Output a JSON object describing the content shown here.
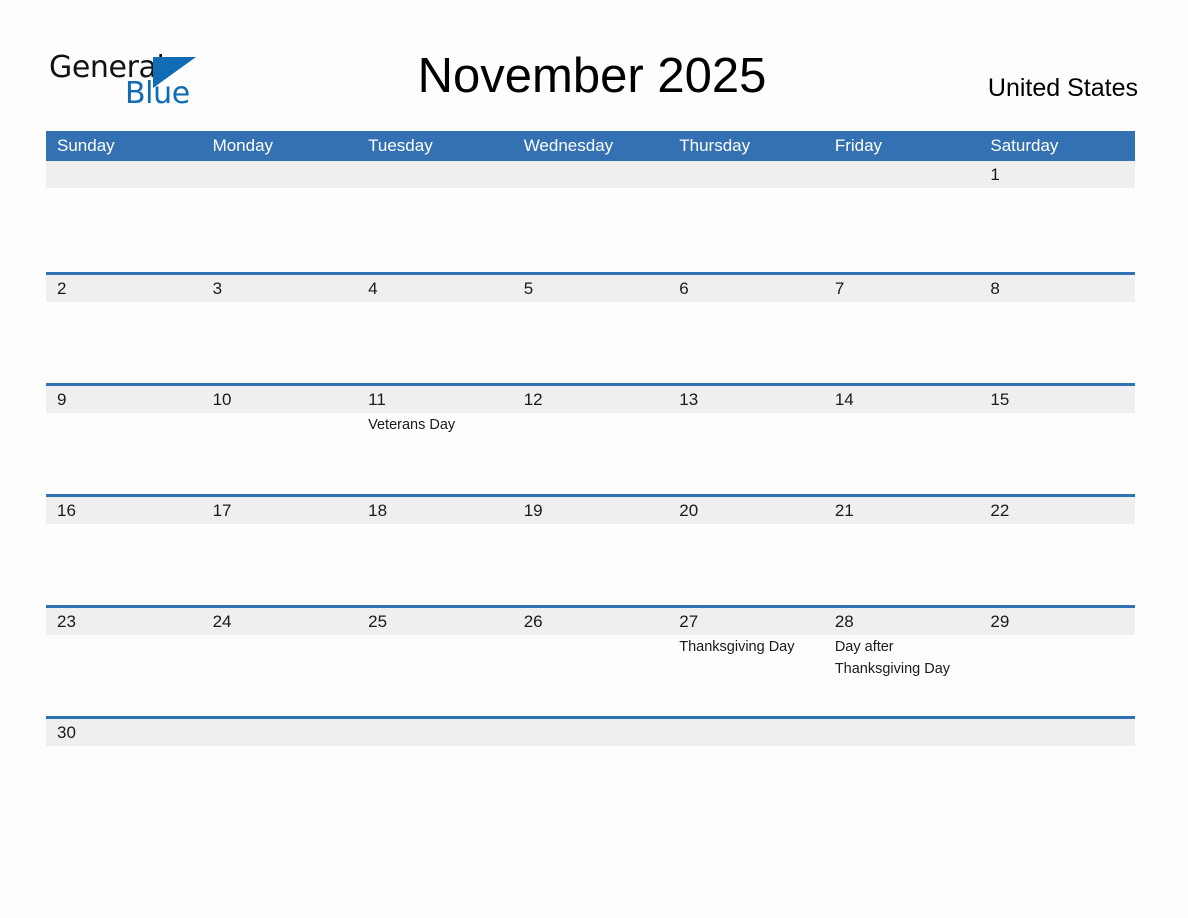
{
  "brand": {
    "name_line1": "General",
    "name_line2": "Blue",
    "triangle_icon": "triangle-icon",
    "color_text": "#131313",
    "color_accent": "#0f6cb5"
  },
  "header": {
    "title": "November 2025",
    "region": "United States"
  },
  "theme": {
    "header_blue": "#3371b3",
    "row_divider_blue": "#2f72b4",
    "date_band_gray": "#efefef",
    "page_background": "#fdfdfd",
    "text_color": "#1a1a1a"
  },
  "calendar": {
    "month": "November",
    "year": "2025",
    "weekday_headers": [
      "Sunday",
      "Monday",
      "Tuesday",
      "Wednesday",
      "Thursday",
      "Friday",
      "Saturday"
    ],
    "weeks": [
      {
        "days": [
          {
            "number": "",
            "events": []
          },
          {
            "number": "",
            "events": []
          },
          {
            "number": "",
            "events": []
          },
          {
            "number": "",
            "events": []
          },
          {
            "number": "",
            "events": []
          },
          {
            "number": "",
            "events": []
          },
          {
            "number": "1",
            "events": []
          }
        ]
      },
      {
        "days": [
          {
            "number": "2",
            "events": []
          },
          {
            "number": "3",
            "events": []
          },
          {
            "number": "4",
            "events": []
          },
          {
            "number": "5",
            "events": []
          },
          {
            "number": "6",
            "events": []
          },
          {
            "number": "7",
            "events": []
          },
          {
            "number": "8",
            "events": []
          }
        ]
      },
      {
        "days": [
          {
            "number": "9",
            "events": []
          },
          {
            "number": "10",
            "events": []
          },
          {
            "number": "11",
            "events": [
              "Veterans Day"
            ]
          },
          {
            "number": "12",
            "events": []
          },
          {
            "number": "13",
            "events": []
          },
          {
            "number": "14",
            "events": []
          },
          {
            "number": "15",
            "events": []
          }
        ]
      },
      {
        "days": [
          {
            "number": "16",
            "events": []
          },
          {
            "number": "17",
            "events": []
          },
          {
            "number": "18",
            "events": []
          },
          {
            "number": "19",
            "events": []
          },
          {
            "number": "20",
            "events": []
          },
          {
            "number": "21",
            "events": []
          },
          {
            "number": "22",
            "events": []
          }
        ]
      },
      {
        "days": [
          {
            "number": "23",
            "events": []
          },
          {
            "number": "24",
            "events": []
          },
          {
            "number": "25",
            "events": []
          },
          {
            "number": "26",
            "events": []
          },
          {
            "number": "27",
            "events": [
              "Thanksgiving Day"
            ]
          },
          {
            "number": "28",
            "events": [
              "Day after Thanksgiving Day"
            ]
          },
          {
            "number": "29",
            "events": []
          }
        ]
      },
      {
        "days": [
          {
            "number": "30",
            "events": []
          },
          {
            "number": "",
            "events": []
          },
          {
            "number": "",
            "events": []
          },
          {
            "number": "",
            "events": []
          },
          {
            "number": "",
            "events": []
          },
          {
            "number": "",
            "events": []
          },
          {
            "number": "",
            "events": []
          }
        ]
      }
    ]
  }
}
